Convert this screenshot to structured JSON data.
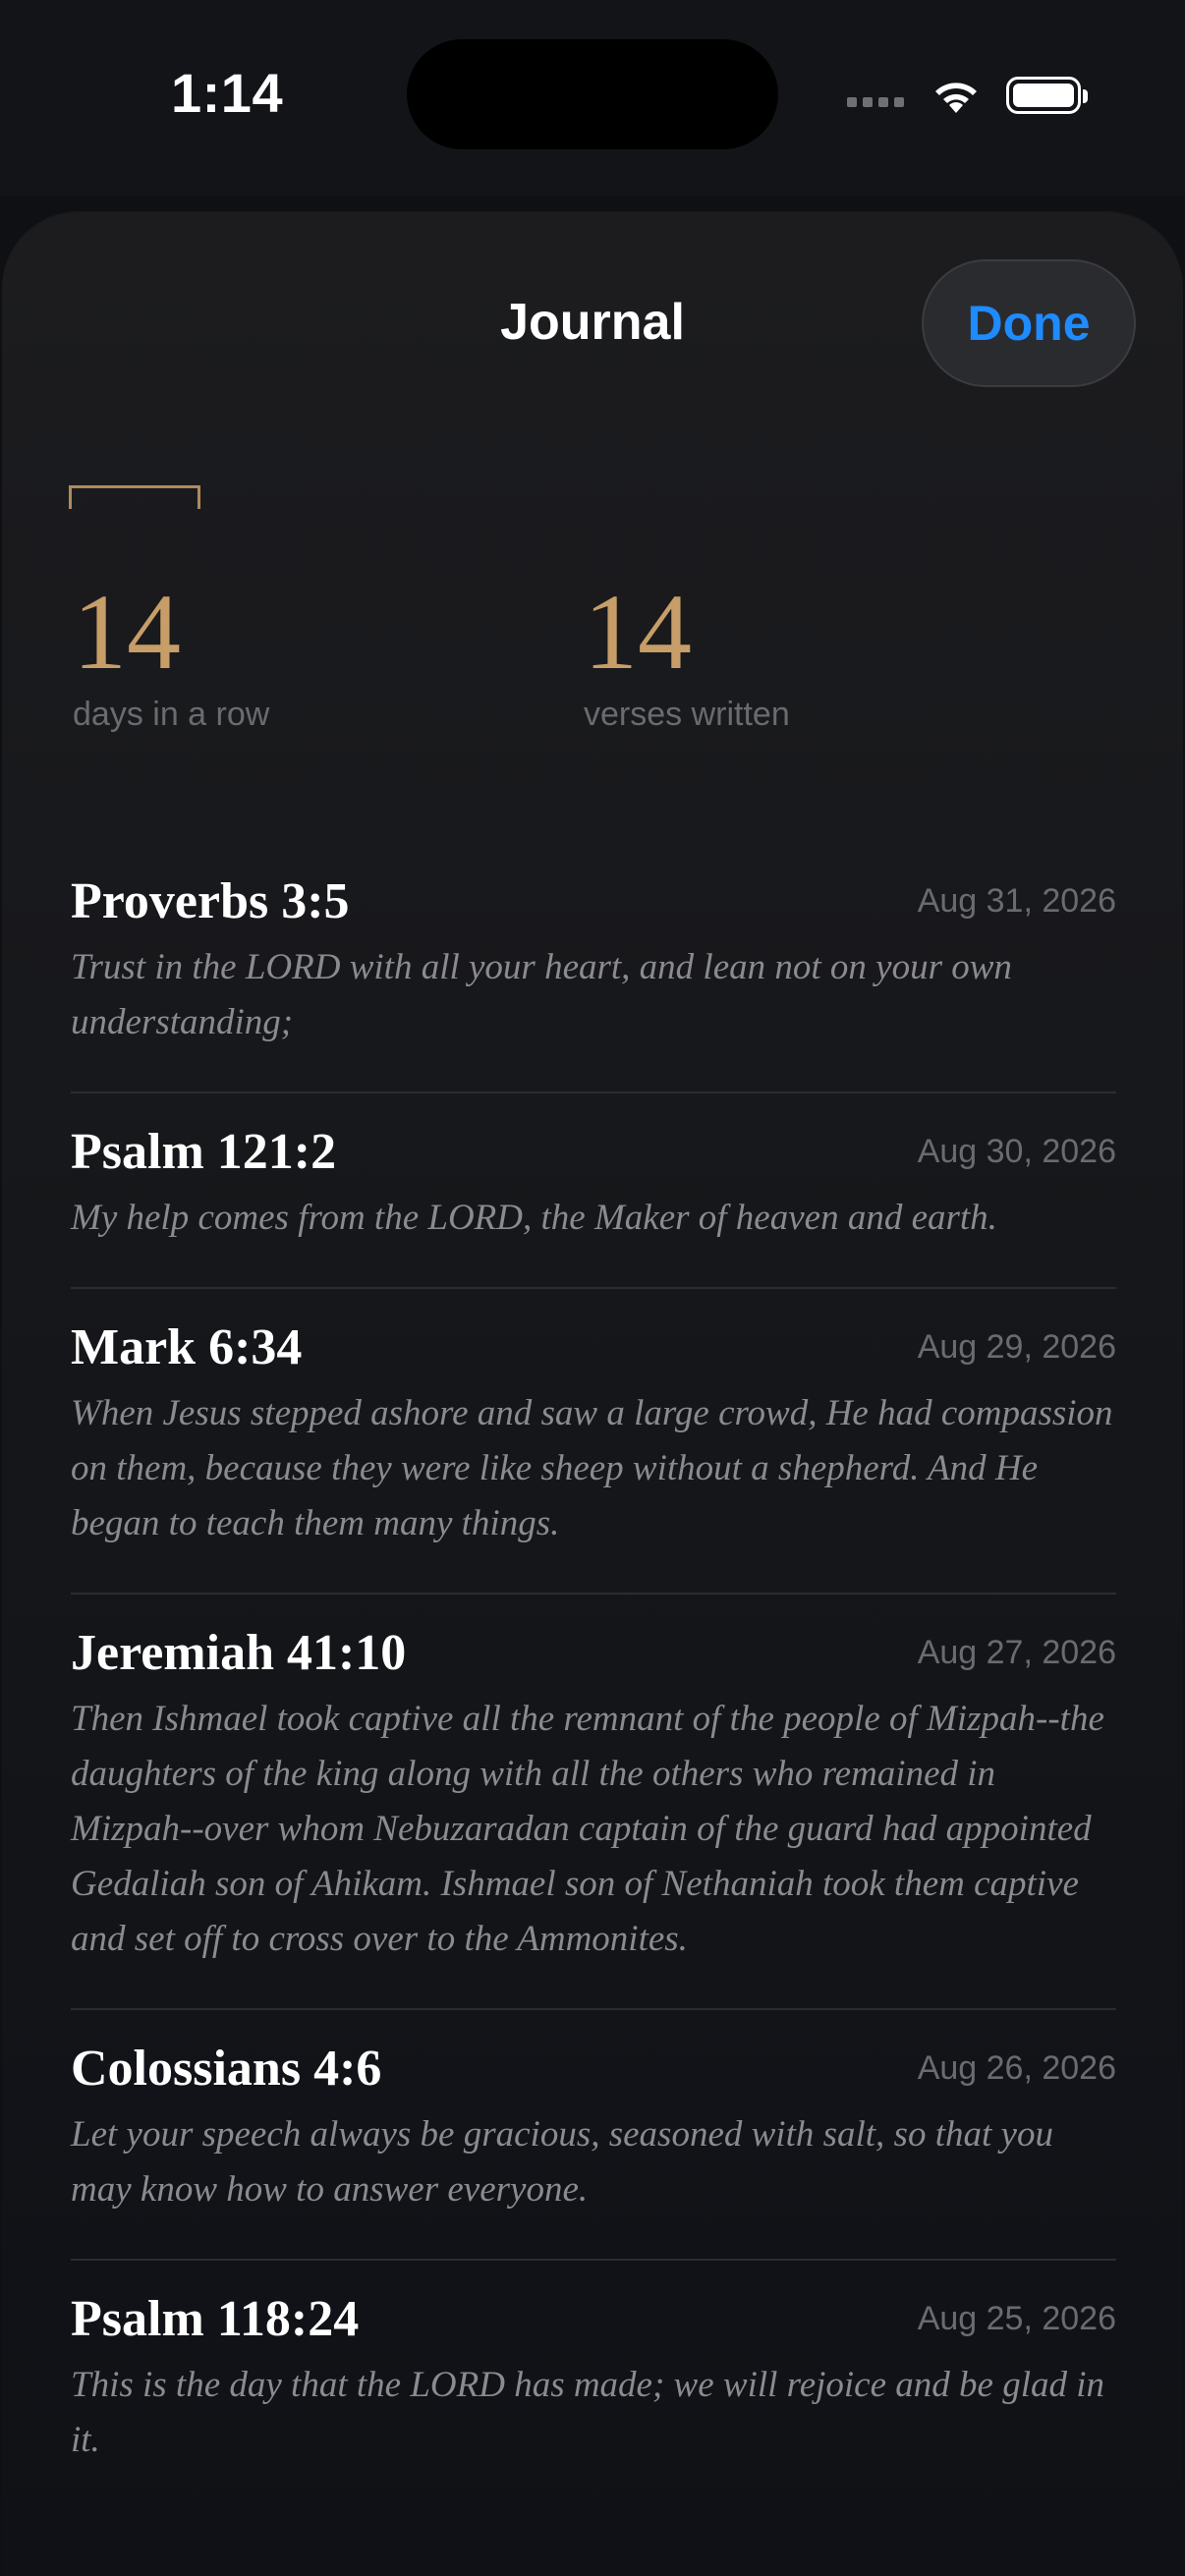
{
  "status_bar": {
    "time": "1:14",
    "icons": [
      "signal-dots-icon",
      "wifi-icon",
      "battery-icon"
    ]
  },
  "header": {
    "title": "Journal",
    "done_label": "Done"
  },
  "stats": [
    {
      "value": "14",
      "label": "days in a row"
    },
    {
      "value": "14",
      "label": "verses written"
    }
  ],
  "entries": [
    {
      "reference": "Proverbs 3:5",
      "date": "Aug 31, 2026",
      "text": "Trust in the LORD with all your heart, and lean not on your own understanding;"
    },
    {
      "reference": "Psalm 121:2",
      "date": "Aug 30, 2026",
      "text": "My help comes from the LORD, the Maker of heaven and earth."
    },
    {
      "reference": "Mark 6:34",
      "date": "Aug 29, 2026",
      "text": "When Jesus stepped ashore and saw a large crowd, He had compassion on them, because they were like sheep without a shepherd. And He began to teach them many things."
    },
    {
      "reference": "Jeremiah 41:10",
      "date": "Aug 27, 2026",
      "text": "Then Ishmael took captive all the remnant of the people of Mizpah--the daughters of the king along with all the others who remained in Mizpah--over whom Nebuzaradan captain of the guard had appointed Gedaliah son of Ahikam. Ishmael son of Nethaniah took them captive and set off to cross over to the Ammonites."
    },
    {
      "reference": "Colossians 4:6",
      "date": "Aug 26, 2026",
      "text": "Let your speech always be gracious, seasoned with salt, so that you may know how to answer everyone."
    },
    {
      "reference": "Psalm 118:24",
      "date": "Aug 25, 2026",
      "text": "This is the day that the LORD has made; we will rejoice and be glad in it."
    }
  ],
  "colors": {
    "accent": "#c79d68",
    "link": "#1e8bff",
    "background": "#0f1013"
  }
}
